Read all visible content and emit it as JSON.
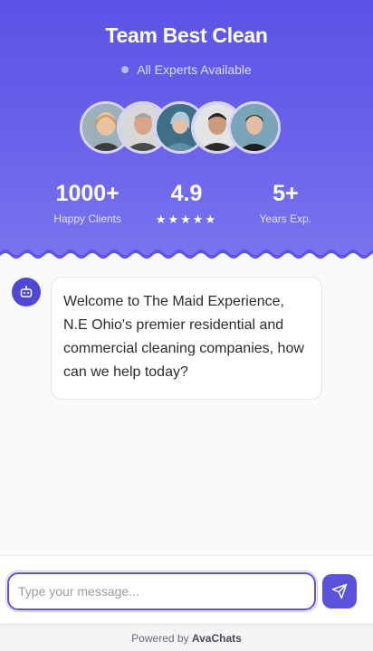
{
  "header": {
    "title": "Team Best Clean",
    "status": "All Experts Available",
    "avatars": [
      "expert-1",
      "expert-2",
      "expert-3",
      "expert-4",
      "expert-5"
    ],
    "stats": [
      {
        "value": "1000+",
        "label": "Happy Clients"
      },
      {
        "value": "4.9",
        "stars": "★★★★★"
      },
      {
        "value": "5+",
        "label": "Years Exp."
      }
    ]
  },
  "chat": {
    "messages": [
      {
        "sender": "bot",
        "text": "Welcome to The Maid Experience, N.E Ohio's premier residential and commercial cleaning companies, how can we help today?"
      }
    ]
  },
  "composer": {
    "placeholder": "Type your message...",
    "send_icon": "send-icon"
  },
  "footer": {
    "prefix": "Powered by",
    "brand": "AvaChats"
  },
  "colors": {
    "primary": "#5a51dc",
    "header_top": "#5b53e6",
    "header_bottom": "#7a74ee"
  }
}
